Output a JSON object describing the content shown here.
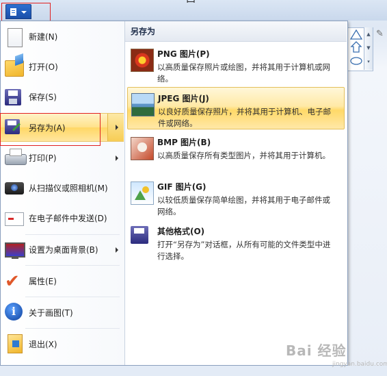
{
  "window": {
    "title_fragment": "西"
  },
  "app_menu": {
    "left_items": [
      {
        "label": "新建(N)",
        "icon": "new-file-icon",
        "has_submenu": false
      },
      {
        "label": "打开(O)",
        "icon": "open-folder-icon",
        "has_submenu": false
      },
      {
        "label": "保存(S)",
        "icon": "save-icon",
        "has_submenu": false
      },
      {
        "label": "另存为(A)",
        "icon": "save-as-icon",
        "has_submenu": true,
        "selected": true
      },
      {
        "label": "打印(P)",
        "icon": "printer-icon",
        "has_submenu": true
      },
      {
        "label": "从扫描仪或照相机(M)",
        "icon": "scanner-icon",
        "has_submenu": false
      },
      {
        "label": "在电子邮件中发送(D)",
        "icon": "email-icon",
        "has_submenu": false
      },
      {
        "label": "设置为桌面背景(B)",
        "icon": "desktop-background-icon",
        "has_submenu": true
      },
      {
        "label": "属性(E)",
        "icon": "properties-check-icon",
        "has_submenu": false
      },
      {
        "label": "关于画图(T)",
        "icon": "info-icon",
        "has_submenu": false
      },
      {
        "label": "退出(X)",
        "icon": "exit-icon",
        "has_submenu": false
      }
    ],
    "submenu": {
      "title": "另存为",
      "items": [
        {
          "title": "PNG 图片(P)",
          "desc": "以高质量保存照片或绘图，并将其用于计算机或网络。",
          "icon": "png-image-icon"
        },
        {
          "title": "JPEG 图片(J)",
          "desc": "以良好质量保存照片，并将其用于计算机、电子邮件或网络。",
          "icon": "jpeg-image-icon",
          "selected": true
        },
        {
          "title": "BMP 图片(B)",
          "desc": "以高质量保存所有类型图片，并将其用于计算机。",
          "icon": "bmp-image-icon"
        },
        {
          "title": "GIF 图片(G)",
          "desc": "以较低质量保存简单绘图，并将其用于电子邮件或网络。",
          "icon": "gif-image-icon"
        },
        {
          "title": "其他格式(O)",
          "desc": "打开“另存为”对话框，从所有可能的文件类型中进行选择。",
          "icon": "other-formats-icon"
        }
      ]
    }
  },
  "colors": {
    "highlight_top": "#fff3c8",
    "highlight_bottom": "#ffd765",
    "app_button": "#2c6fd1",
    "annotation_red": "#e02020"
  },
  "watermark": {
    "text": "Bai 经验",
    "sub": "jingyan.baidu.com"
  }
}
